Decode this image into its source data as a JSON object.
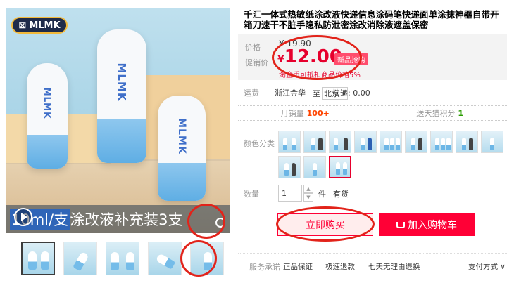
{
  "gallery": {
    "brand": "MLMK",
    "bottle_text": "MLMK",
    "caption_highlight": "10ml/支",
    "caption_rest": " 涂改液补充装3支",
    "thumb_count": 5
  },
  "product": {
    "title": "千汇一体式热敏纸涂改液快递信息涂码笔快递面单涂抹神器自带开箱刀速干不脏手隐私防泄密涂改消除液遮盖保密"
  },
  "price": {
    "original_label": "价格",
    "original_value": "¥ 19.90",
    "promo_label": "促销价",
    "currency": "¥",
    "promo_value": "12.00",
    "promo_tag": "新品抢购",
    "coin_note": "淘金币可抵扣商品价格5%"
  },
  "shipping": {
    "label": "运费",
    "from": "浙江金华",
    "to_prefix": "至",
    "to": "北京",
    "fee": "快递: 0.00"
  },
  "stats": {
    "monthly_label": "月销量",
    "monthly_value": "100+",
    "points_label": "送天猫积分",
    "points_value": "1"
  },
  "sku": {
    "color_label": "颜色分类",
    "swatch_count": 10,
    "selected_index": 9
  },
  "quantity": {
    "label": "数量",
    "value": "1",
    "unit": "件",
    "stock": "有货"
  },
  "actions": {
    "buy_now": "立即购买",
    "add_cart": "加入购物车"
  },
  "service": {
    "label": "服务承诺",
    "items": [
      "正品保证",
      "极速退款",
      "七天无理由退换"
    ],
    "payment": "支付方式 ∨"
  },
  "colors": {
    "accent": "#ff0036",
    "price_red": "#e6002d",
    "panel_bg": "#f3f3f3"
  }
}
